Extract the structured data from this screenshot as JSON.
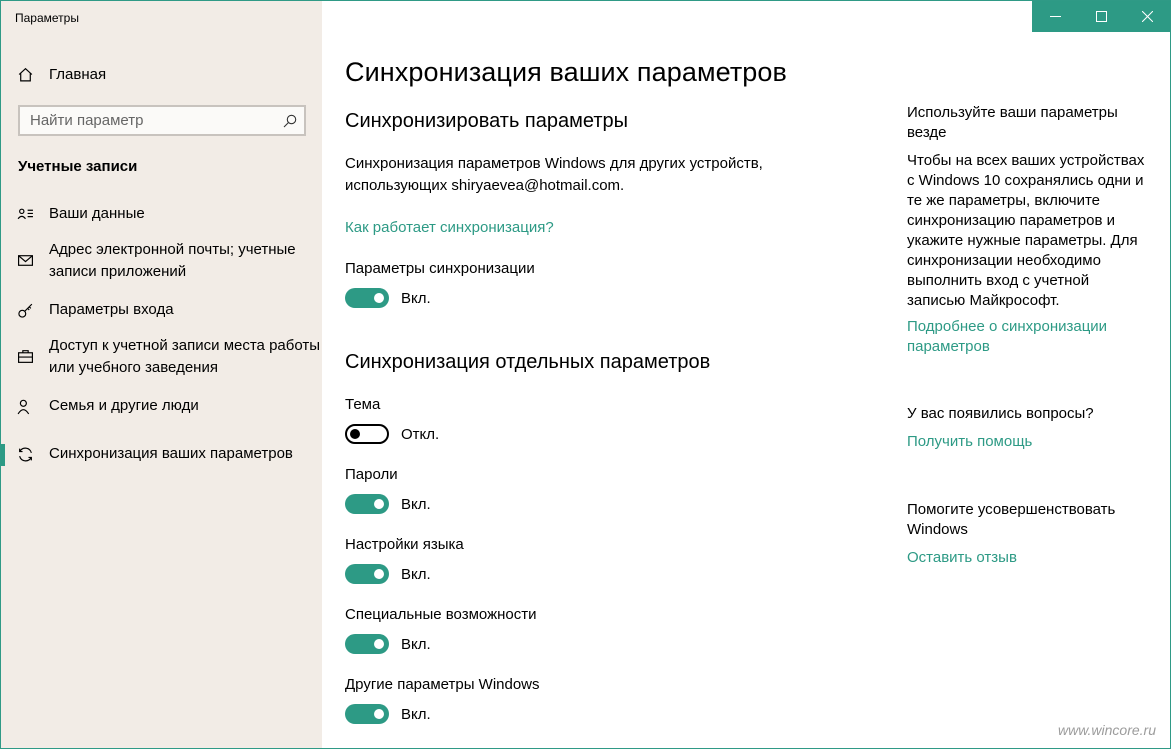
{
  "window": {
    "title": "Параметры"
  },
  "sidebar": {
    "home_label": "Главная",
    "search_placeholder": "Найти параметр",
    "section_title": "Учетные записи",
    "items": [
      {
        "label": "Ваши данные",
        "icon": "person-card-icon"
      },
      {
        "label": "Адрес электронной почты; учетные записи приложений",
        "icon": "mail-icon"
      },
      {
        "label": "Параметры входа",
        "icon": "key-icon"
      },
      {
        "label": "Доступ к учетной записи места работы или учебного заведения",
        "icon": "briefcase-icon"
      },
      {
        "label": "Семья и другие люди",
        "icon": "people-icon"
      },
      {
        "label": "Синхронизация ваших параметров",
        "icon": "sync-icon",
        "selected": true
      }
    ]
  },
  "main": {
    "title": "Синхронизация ваших параметров",
    "sync_heading": "Синхронизировать параметры",
    "sync_description": "Синхронизация параметров Windows для других устройств, использующих shiryaevea@hotmail.com.",
    "how_link": "Как работает синхронизация?",
    "sync_settings": {
      "label": "Параметры синхронизации",
      "state": "Вкл.",
      "on": true
    },
    "individual_heading": "Синхронизация отдельных параметров",
    "individual": [
      {
        "label": "Тема",
        "state": "Откл.",
        "on": false
      },
      {
        "label": "Пароли",
        "state": "Вкл.",
        "on": true
      },
      {
        "label": "Настройки языка",
        "state": "Вкл.",
        "on": true
      },
      {
        "label": "Специальные возможности",
        "state": "Вкл.",
        "on": true
      },
      {
        "label": "Другие параметры Windows",
        "state": "Вкл.",
        "on": true
      }
    ]
  },
  "right": {
    "heading": "Используйте ваши параметры везде",
    "body": "Чтобы на всех ваших устройствах с Windows 10 сохранялись одни и те же параметры, включите синхронизацию параметров и укажите нужные параметры. Для синхронизации необходимо выполнить вход с учетной записью Майкрософт.",
    "more_link": "Подробнее о синхронизации параметров",
    "questions": "У вас появились вопросы?",
    "help_link": "Получить помощь",
    "improve": "Помогите усовершенствовать Windows",
    "feedback_link": "Оставить отзыв"
  },
  "watermark": "www.wincore.ru",
  "colors": {
    "accent": "#2d9a85",
    "sidebar_bg": "#f2ece6"
  }
}
